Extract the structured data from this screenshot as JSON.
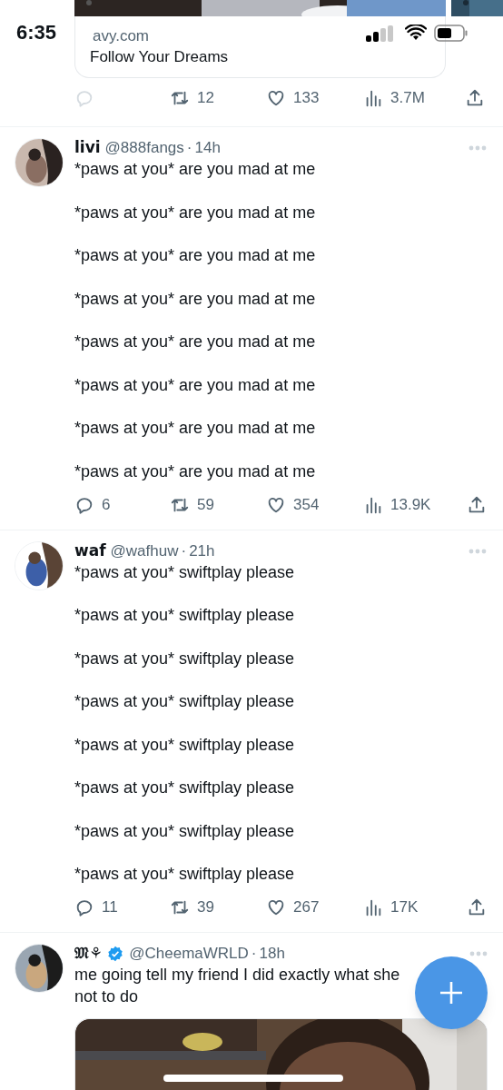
{
  "status_bar": {
    "time": "6:35"
  },
  "link_card": {
    "domain": "avy.com",
    "title": "Follow Your Dreams"
  },
  "top_actions": {
    "reply_dimmed": true,
    "items": [
      {
        "kind": "reply"
      },
      {
        "kind": "retweet",
        "count": "12"
      },
      {
        "kind": "like",
        "count": "133"
      },
      {
        "kind": "views",
        "count": "3.7M"
      },
      {
        "kind": "share"
      }
    ]
  },
  "tweets": [
    {
      "name": "livi",
      "verified": false,
      "handle": "@888fangs",
      "separator": "·",
      "time": "14h",
      "line_gap": true,
      "lines": [
        "*paws at you* are you mad at me",
        "*paws at you* are you mad at me",
        "*paws at you* are you mad at me",
        "*paws at you* are you mad at me",
        "*paws at you* are you mad at me",
        "*paws at you* are you mad at me",
        "*paws at you* are you mad at me",
        "*paws at you* are you mad at me"
      ],
      "actions": [
        {
          "kind": "reply",
          "count": "6"
        },
        {
          "kind": "retweet",
          "count": "59"
        },
        {
          "kind": "like",
          "count": "354"
        },
        {
          "kind": "views",
          "count": "13.9K"
        },
        {
          "kind": "share"
        }
      ]
    },
    {
      "name": "waf",
      "verified": false,
      "handle": "@wafhuw",
      "separator": "·",
      "time": "21h",
      "line_gap": true,
      "lines": [
        "*paws at you* swiftplay please",
        "*paws at you* swiftplay please",
        "*paws at you* swiftplay please",
        "*paws at you* swiftplay please",
        "*paws at you* swiftplay please",
        "*paws at you* swiftplay please",
        "*paws at you* swiftplay please",
        "*paws at you* swiftplay please"
      ],
      "actions": [
        {
          "kind": "reply",
          "count": "11"
        },
        {
          "kind": "retweet",
          "count": "39"
        },
        {
          "kind": "like",
          "count": "267"
        },
        {
          "kind": "views",
          "count": "17K"
        },
        {
          "kind": "share"
        }
      ]
    },
    {
      "name": "𝔐⚘",
      "verified": true,
      "handle": "@CheemaWRLD",
      "separator": "·",
      "time": "18h",
      "line_gap": false,
      "lines": [
        "me going tell my friend I did exactly what she",
        "not to do"
      ],
      "media": {
        "kind": "picture"
      }
    }
  ]
}
